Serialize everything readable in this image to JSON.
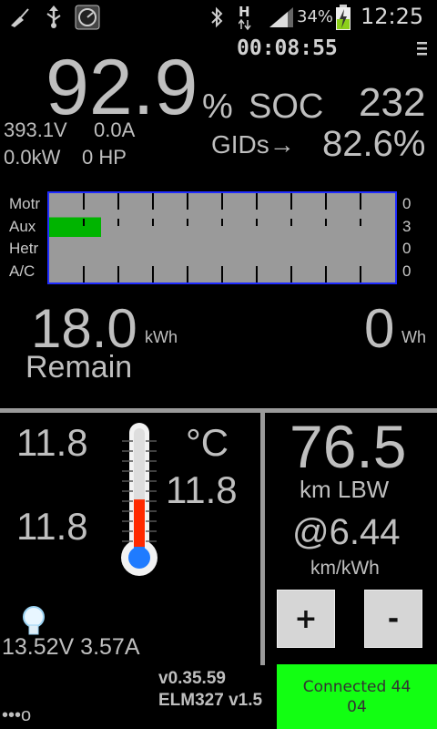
{
  "status_bar": {
    "battery_percent": "34%",
    "clock": "12:25",
    "network_label": "H"
  },
  "timer": "00:08:55",
  "menu_icon": "≡",
  "soc": {
    "value": "92.9",
    "unit": "%",
    "label": "SOC",
    "gids_value": "232",
    "gids_label": "GIDs→",
    "gids_percent": "82.6%"
  },
  "electrical": {
    "voltage": "393.1V",
    "current": "0.0A",
    "power_kw": "0.0kW",
    "power_hp": "0 HP"
  },
  "usage_bars": {
    "rows": [
      {
        "label": "Motr",
        "value": "0",
        "level": 0
      },
      {
        "label": "Aux",
        "value": "3",
        "level": 0.15
      },
      {
        "label": "Hetr",
        "value": "0",
        "level": 0
      },
      {
        "label": "A/C",
        "value": "0",
        "level": 0
      }
    ],
    "colors": {
      "fill": "#00b400",
      "background": "#9a9a9a",
      "border": "#1f2bff"
    }
  },
  "energy": {
    "remain_value": "18.0",
    "remain_unit": "kWh",
    "remain_label": "Remain",
    "used_value": "0",
    "used_unit": "Wh"
  },
  "temperature": {
    "left_top": "11.8",
    "left_bottom": "11.8",
    "unit": "°C",
    "right": "11.8",
    "thermo_level": 0.45,
    "thermo_color": "#ff2a00",
    "bulb_color": "#1f7bff"
  },
  "aux_battery": {
    "readout": "13.52V 3.57A"
  },
  "range": {
    "value": "76.5",
    "label": "km LBW",
    "efficiency": "@6.44",
    "efficiency_unit": "km/kWh",
    "plus_label": "+",
    "minus_label": "-"
  },
  "version": {
    "app": "v0.35.59",
    "adapter": "ELM327 v1.5"
  },
  "connection": {
    "line1": "Connected 44",
    "line2": "04",
    "color": "#12ff12"
  },
  "page_dots": "•••o"
}
